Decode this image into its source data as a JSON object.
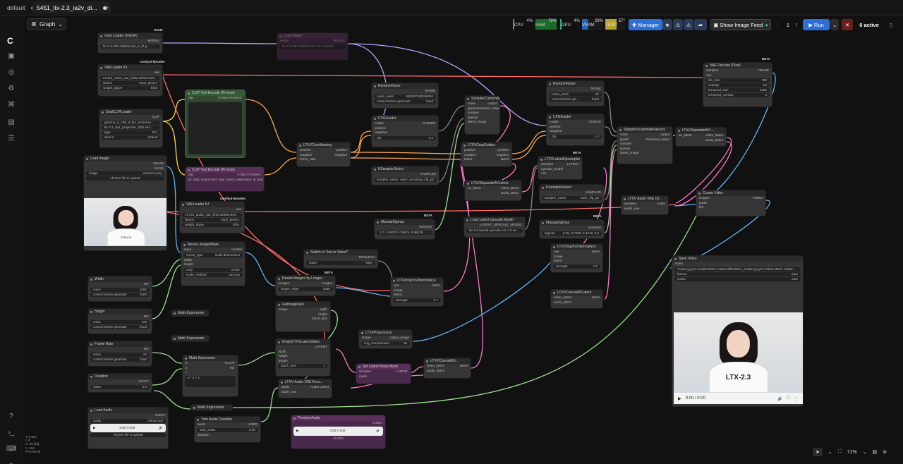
{
  "tabs": [
    {
      "label": "default"
    },
    {
      "label": "5451_ltx-2.3_ia2v_di..."
    }
  ],
  "graph_label": "Graph",
  "meters": {
    "cpu": "4%",
    "cpu_label": "CPU",
    "ram": "79%",
    "ram_label": "RAM",
    "gpu": "4%",
    "gpu_label": "GPU",
    "vram": "29%",
    "vram_label": "VRAM",
    "temp": "57°",
    "temp_label": "TEMP"
  },
  "toolbar": {
    "manager": "Manager",
    "show_feed": "Show Image Feed",
    "queue_count": "1",
    "run": "Run",
    "active": "0 active"
  },
  "nodes": {
    "unet_loader": {
      "title": "Unet Loader (GGUF)",
      "out": "MODEL",
      "value": "ltx-2.3-22b-distilled-Q4_K_M.g...",
      "badge": "GGUF"
    },
    "vae_loader1": {
      "title": "VAELoader KJ",
      "out": "vae",
      "v1": "LTX23_video_vae_bf16.safetensors",
      "l2": "device",
      "v2": "main_device",
      "l3": "weight_dtype",
      "v3": "bf16",
      "badge": "comfyui-kjnodes"
    },
    "dual_clip": {
      "title": "DualCLIPLoader",
      "out": "CLIP",
      "v1": "gemma_3_12B_it_fp4_mixed.sa...",
      "v2": "ltx-2.3_text_projection_bf16.saf...",
      "l3": "type",
      "v3": "ltxv",
      "l4": "device",
      "v4": "default"
    },
    "clip_pos": {
      "title": "CLIP Text Encode (Prompt)",
      "in": "clip",
      "out": "CONDITIONING"
    },
    "clip_neg": {
      "title": "CLIP Text Encode (Prompt)",
      "in": "clip",
      "out": "CONDITIONING",
      "text": "pc, bad, motion blur, logo, blurry, watermark, ai, bad..."
    },
    "load_image": {
      "title": "Load Image",
      "o1": "IMAGE",
      "o2": "MASK",
      "l1": "image",
      "v1": "woman4.png",
      "btn": "choose file to upload",
      "caption": "LTX-2.3"
    },
    "vae_loader2": {
      "title": "VAELoader KJ",
      "out": "vae",
      "v1": "LTX23_audio_vae_bf16.safetensors",
      "l2": "device",
      "v2": "main_device",
      "l3": "weight_dtype",
      "v3": "bf16",
      "badge": "comfyui-kjnodes"
    },
    "resize_mask": {
      "title": "Resize Image/Mask",
      "in": "input",
      "out": "resized",
      "l1": "resize_type",
      "v1": "scale dimensions",
      "l2": "crop",
      "v2": "center",
      "l3": "scale_method",
      "v3": "lanczos",
      "r1": "width",
      "r2": "height"
    },
    "ltxv_cond": {
      "title": "LTXVConditioning",
      "i1": "positive",
      "i2": "negative",
      "o1": "positive",
      "o2": "negative",
      "r1": "frame_rate"
    },
    "random_noise1": {
      "title": "RandomNoise",
      "out": "NOISE",
      "l1": "noise_seed",
      "v1": "832067491199404",
      "l2": "control before generate",
      "v2": "fixed"
    },
    "cfg_guider1": {
      "title": "CFGGuider",
      "i1": "model",
      "i2": "positive",
      "i3": "negative",
      "out": "GUIDER",
      "l1": "cfg",
      "v1": "1.0"
    },
    "ksampler_select1": {
      "title": "KSamplerSelect",
      "out": "SAMPLER",
      "l1": "sampler_name",
      "v1": "euler_ancestral_cfg_pp"
    },
    "manual_sigmas1": {
      "title": "ManualSigmas",
      "out": "SIGMAS",
      "v1": "1.0, 0.99375, 0.9875, 0.98125, ...",
      "badge": "BETA"
    },
    "sampler_custom1": {
      "title": "SamplerCustomAdvanced",
      "i1": "noise",
      "i2": "guider",
      "i3": "sampler",
      "i4": "sigmas",
      "i5": "latent_image",
      "o1": "output",
      "o2": "denoised_output"
    },
    "ltxv_crop": {
      "title": "LTXVCropGuides",
      "i1": "positive",
      "i2": "negative",
      "i3": "latent",
      "o1": "positive",
      "o2": "negative",
      "o3": "latent"
    },
    "ltxv_sep1": {
      "title": "LTXVSeparateAVLatent",
      "in": "av_latent",
      "o1": "video_latent",
      "o2": "audio_latent"
    },
    "load_upscale": {
      "title": "Load Latent Upscale Model",
      "out": "LATENT_UPSCALE_MODEL",
      "v1": "ltx-2.3-spatial-upscaler-x2-1.0.sa..."
    },
    "random_noise2": {
      "title": "RandomNoise",
      "out": "NOISE",
      "l1": "noise_seed",
      "v1": "42",
      "l2": "control before ge...",
      "v2": "fixed"
    },
    "cfg_guider2": {
      "title": "CFGGuider",
      "i1": "model",
      "i2": "positive",
      "i3": "negative",
      "out": "GUIDER",
      "l1": "cfg",
      "v1": "1.0"
    },
    "ltxv_latent_up": {
      "title": "LTXVLatentUpsampler",
      "i1": "samples",
      "i2": "upscale_model",
      "i3": "vae",
      "out": "LATENT",
      "badge": "BETA"
    },
    "ksampler_select2": {
      "title": "KSamplerSelect",
      "out": "SAMPLER",
      "l1": "sampler_name",
      "v1": "euler_cfg_pp"
    },
    "manual_sigmas2": {
      "title": "ManualSigmas",
      "out": "SIGMAS",
      "l1": "sigmas",
      "v1": "0.85, 0.7250, 0.4219, 0.0",
      "badge": "BETA"
    },
    "ltxv_img_inplace2": {
      "title": "LTXVImgToVideoInplace",
      "i1": "vae",
      "i2": "image",
      "i3": "latent",
      "out": "latent",
      "l1": "strength",
      "v1": "1.0"
    },
    "ltxv_concat2": {
      "title": "LTXVConcatAVLatent",
      "i1": "video_latent",
      "i2": "audio_latent",
      "out": "latent"
    },
    "sampler_custom2": {
      "title": "SamplerCustomAdvanced",
      "i1": "noise",
      "i2": "guider",
      "i3": "sampler",
      "i4": "sigmas",
      "i5": "latent_image",
      "o1": "output",
      "o2": "denoised_output"
    },
    "ltxv_sep2": {
      "title": "LTXVSeparateAVL...",
      "in": "av_latent",
      "o1": "video_latent",
      "o2": "audio_latent"
    },
    "vae_decode_tiled": {
      "title": "VAE Decode (Tiled)",
      "i1": "samples",
      "i2": "vae",
      "out": "IMAGE",
      "l1": "tile_size",
      "v1": "768",
      "l2": "overlap",
      "v2": "64",
      "l3": "temporal_size",
      "v3": "4096",
      "l4": "temporal_overlap",
      "v4": "4",
      "badge": "BETA"
    },
    "audio_vae_decode": {
      "title": "LTXV Audio VAE De...",
      "i1": "samples",
      "i2": "audio_vae",
      "out": "Audio"
    },
    "create_video": {
      "title": "Create Video",
      "i1": "images",
      "i2": "audio",
      "i3": "fps",
      "out": "VIDEO"
    },
    "save_video": {
      "title": "Save Video",
      "in": "video",
      "v1": "%date:yyyy%-%date:MM%-%date:dd%/5451_%date:yyyy%-%date:MM%-%date...",
      "l2": "format",
      "v2": "auto",
      "l3": "codec",
      "v3": "auto",
      "time": "0:00 / 0:00",
      "caption": "LTX-2.3"
    },
    "switch": {
      "title": "Switch to Text to Video?",
      "out": "BOOLEAN",
      "l1": "value",
      "v1": "false"
    },
    "resize_longer": {
      "title": "Resize Images by Longer...",
      "in": "images",
      "out": "images",
      "l1": "longer_edge",
      "v1": "1536",
      "badge": "BETA"
    },
    "get_image_size": {
      "title": "GetImageSize",
      "i1": "image",
      "o1": "width",
      "o2": "height",
      "o3": "batch_size"
    },
    "empty_latent": {
      "title": "EmptyLTXVLatentVideo",
      "out": "LATENT",
      "r1": "width",
      "r2": "height",
      "r3": "length",
      "l4": "batch_size",
      "v4": "1"
    },
    "audio_vae_encode": {
      "title": "LTXV Audio VAE Enco...",
      "i1": "audio",
      "i2": "audio_vae",
      "out": "Audio Latent"
    },
    "ltxv_img_inplace1": {
      "title": "LTXVImgToVideoInplace",
      "i1": "vae",
      "i2": "image",
      "i3": "latent",
      "out": "latent",
      "l1": "strength",
      "v1": "0.7"
    },
    "ltxv_preprocess": {
      "title": "LTXVPreprocess",
      "in": "image",
      "out": "output_image",
      "l1": "img_compression",
      "v1": "18"
    },
    "set_noise_mask": {
      "title": "Set Latent Noise Mask",
      "i1": "samples",
      "i2": "mask",
      "out": "LATENT"
    },
    "ltxv_concat1": {
      "title": "LTXVConcatAVL...",
      "i1": "video_latent",
      "i2": "audio_latent",
      "out": "latent"
    },
    "width": {
      "title": "Width",
      "out": "INT",
      "l1": "value",
      "v1": "1080",
      "l2": "control before generate",
      "v2": "fixed"
    },
    "height": {
      "title": "Height",
      "out": "INT",
      "l1": "value",
      "v1": "720",
      "l2": "control before generate",
      "v2": "fixed"
    },
    "frame_rate": {
      "title": "Frame Rate",
      "out": "INT",
      "l1": "value",
      "v1": "24",
      "l2": "control before generate",
      "v2": "fixed"
    },
    "duration": {
      "title": "Duration",
      "out": "FLOAT",
      "l1": "value",
      "v1": "5.0"
    },
    "math1": {
      "title": "Math Expression"
    },
    "math2": {
      "title": "Math Expression"
    },
    "math3": {
      "title": "Math Expression",
      "i1": "a",
      "i2": "b",
      "i3": "c",
      "o1": "FLOAT",
      "o2": "INT",
      "expr": "a * b + 1"
    },
    "math4": {
      "title": "Math Expression"
    },
    "load_audio": {
      "title": "Load Audio",
      "out": "AUDIO",
      "l1": "audio",
      "v1": "zafrat.mp3",
      "time": "0:00 / 0:03",
      "btn": "choose file to upload"
    },
    "trim_audio": {
      "title": "Trim Audio Duration",
      "in": "audio",
      "out": "AUDIO",
      "l1": "start_index",
      "v1": "0.00",
      "r2": "duration"
    },
    "preview_audio": {
      "title": "Preview Audio",
      "out": "AUDIO",
      "time": "0:00 / 0:00",
      "footer": "AUDIO"
    },
    "load_model": {
      "title": "Load Model",
      "in": "model",
      "out": "MODEL",
      "v1": "ltx-2.3-22b-distilled-lora-384.safeten..."
    }
  },
  "stats": {
    "l1": "T: 0.00s",
    "l2": "I: 0",
    "l3": "N: 58 [58]",
    "l4": "V: 152",
    "l5": "FPS:60.99"
  },
  "zoom": "71%"
}
